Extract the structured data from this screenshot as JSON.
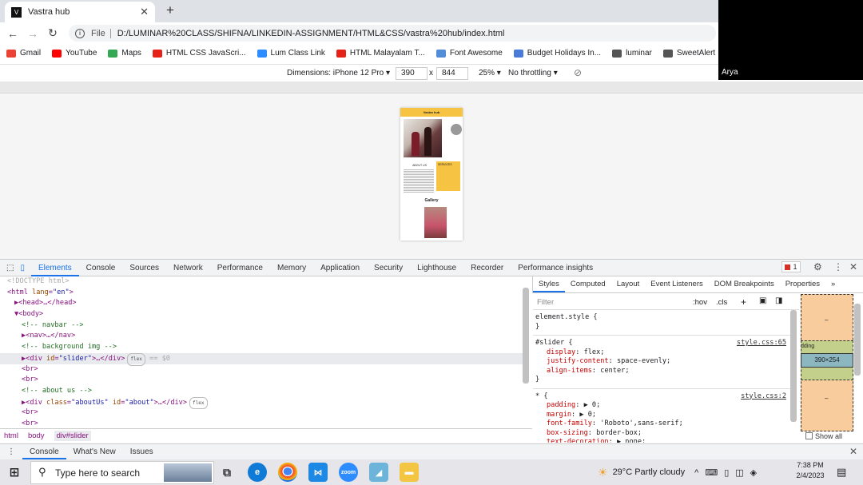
{
  "tab": {
    "title": "Vastra hub",
    "favicon": "V"
  },
  "toolbar": {
    "scheme": "File",
    "url": "D:/LUMINAR%20CLASS/SHIFNA/LINKEDIN-ASSIGNMENT/HTML&CSS/vastra%20hub/index.html"
  },
  "bookmarks": [
    {
      "label": "Gmail",
      "color": "#ea4335"
    },
    {
      "label": "YouTube",
      "color": "#ff0000"
    },
    {
      "label": "Maps",
      "color": "#34a853"
    },
    {
      "label": "HTML CSS JavaScri...",
      "color": "#e62117"
    },
    {
      "label": "Lum Class Link",
      "color": "#2d8cff"
    },
    {
      "label": "HTML Malayalam T...",
      "color": "#e62117"
    },
    {
      "label": "Font Awesome",
      "color": "#528dd7"
    },
    {
      "label": "Budget Holidays In...",
      "color": "#4b7bd9"
    },
    {
      "label": "luminar",
      "color": "#555555"
    },
    {
      "label": "SweetAlert",
      "color": "#555555"
    }
  ],
  "device_toolbar": {
    "dimensions_label": "Dimensions: iPhone 12 Pro",
    "width": "390",
    "times": "x",
    "height": "844",
    "zoom": "25%",
    "throttling": "No throttling"
  },
  "overlay_name": "Arya",
  "preview": {
    "brand": "Vastra hub",
    "about_title": "ABOUT US",
    "services_title": "SERVICES",
    "gallery_title": "Gallery"
  },
  "devtools": {
    "tabs": [
      "Elements",
      "Console",
      "Sources",
      "Network",
      "Performance",
      "Memory",
      "Application",
      "Security",
      "Lighthouse",
      "Recorder",
      "Performance insights"
    ],
    "error_count": "1",
    "breadcrumbs": [
      "html",
      "body",
      "div#slider"
    ],
    "styles_tabs": [
      "Styles",
      "Computed",
      "Layout",
      "Event Listeners",
      "DOM Breakpoints",
      "Properties"
    ],
    "filter_placeholder": "Filter",
    "hov": ":hov",
    "cls": ".cls",
    "box_model_size": "390×254",
    "box_model_padding": "dding",
    "box_model_dash": "–",
    "show_all": "Show all",
    "drawer_tabs": [
      "Console",
      "What's New",
      "Issues"
    ]
  },
  "elements_lines": [
    {
      "t": "<!DOCTYPE html>"
    },
    {
      "t": "<html lang=\"en\">"
    },
    {
      "t": "▶<head>…</head>"
    },
    {
      "t": "▼<body>"
    },
    {
      "t": "<!-- navbar -->"
    },
    {
      "t": "▶<nav>…</nav>"
    },
    {
      "t": "<!-- background img -->"
    },
    {
      "t": "▶<div id=\"slider\">…</div>",
      "pill": "flex",
      "eq": "== $0"
    },
    {
      "t": "<br>"
    },
    {
      "t": "<br>"
    },
    {
      "t": "<!-- about us -->"
    },
    {
      "t": "▶<div class=\"aboutUs\" id=\"about\">…</div>",
      "pill": "flex"
    },
    {
      "t": "<br>"
    },
    {
      "t": "<br>"
    }
  ],
  "styles": {
    "element_style": "element.style {",
    "close": "}",
    "rule1_selector": "#slider {",
    "rule1_source": "style.css:65",
    "rule1_props": [
      "display: flex;",
      "justify-content: space-evenly;",
      "align-items: center;"
    ],
    "rule2_selector": "* {",
    "rule2_source": "style.css:2",
    "rule2_props": [
      "padding: ▶ 0;",
      "margin: ▶ 0;",
      "font-family: 'Roboto',sans-serif;",
      "box-sizing: border-box;",
      "text-decoration: ▶ none;"
    ]
  },
  "taskbar": {
    "search_placeholder": "Type here to search",
    "weather": "29°C  Partly cloudy",
    "time": "7:38 PM",
    "date": "2/4/2023"
  }
}
